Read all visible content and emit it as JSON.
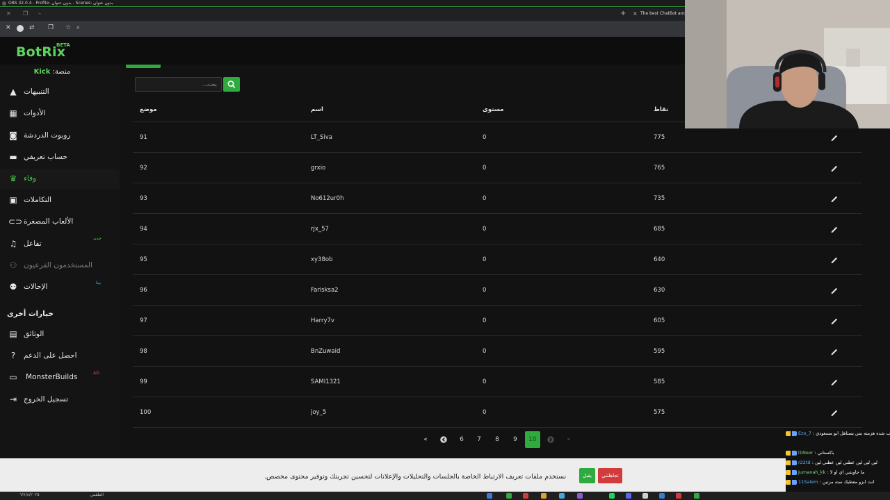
{
  "obs": {
    "title": "OBS 32.0.4 - Profile: بدون عنوان - Scenes: بدون عنوان"
  },
  "browser": {
    "tab_title": "The best ChatBot and W",
    "new_tab_symbol": "+",
    "close_tab_symbol": "×"
  },
  "app": {
    "logo": "BotRix",
    "beta": "BETA",
    "platform_prefix": "منصة:",
    "platform_name": "Kick"
  },
  "sidebar": {
    "items": [
      {
        "label": "التنبيهات",
        "icon": "alert-icon"
      },
      {
        "label": "الأدوات",
        "icon": "grid-icon"
      },
      {
        "label": "روبوت الدردشة",
        "icon": "robot-icon"
      },
      {
        "label": "حساب تعريفي",
        "icon": "id-card-icon"
      },
      {
        "label": "وفاء",
        "icon": "trophy-icon",
        "active": true
      },
      {
        "label": "التكاملات",
        "icon": "plug-icon"
      },
      {
        "label": "الألعاب المصغرة",
        "icon": "gamepad-icon"
      },
      {
        "label": "تفاعل",
        "icon": "music-icon",
        "badge": "جديد"
      },
      {
        "label": "المستخدمون الفرعيون",
        "icon": "users-icon",
        "disabled": true
      },
      {
        "label": "الإحالات",
        "icon": "referrals-icon",
        "badge": "بيتا"
      }
    ],
    "other_title": "خيارات أخرى",
    "other_items": [
      {
        "label": "الوثائق",
        "icon": "book-icon"
      },
      {
        "label": "احصل على الدعم",
        "icon": "help-icon"
      },
      {
        "label": "MonsterBuilds",
        "icon": "laptop-icon",
        "badge": "AD"
      },
      {
        "label": "تسجيل الخروج",
        "icon": "logout-icon"
      }
    ]
  },
  "search": {
    "placeholder": "بحث..."
  },
  "table": {
    "headers": {
      "position": "موضع",
      "name": "اسم",
      "level": "مستوى",
      "points": "نقاط"
    },
    "rows": [
      {
        "position": "91",
        "name": "LT_Siva",
        "level": "0",
        "points": "775"
      },
      {
        "position": "92",
        "name": "grxio",
        "level": "0",
        "points": "765"
      },
      {
        "position": "93",
        "name": "No612ur0h",
        "level": "0",
        "points": "735"
      },
      {
        "position": "94",
        "name": "rjx_57",
        "level": "0",
        "points": "685"
      },
      {
        "position": "95",
        "name": "xy38ob",
        "level": "0",
        "points": "640"
      },
      {
        "position": "96",
        "name": "Farisksa2",
        "level": "0",
        "points": "630"
      },
      {
        "position": "97",
        "name": "Harry7v",
        "level": "0",
        "points": "605"
      },
      {
        "position": "98",
        "name": "BnZuwaid",
        "level": "0",
        "points": "595"
      },
      {
        "position": "99",
        "name": "SAMI1321",
        "level": "0",
        "points": "585"
      },
      {
        "position": "100",
        "name": "joy_5",
        "level": "0",
        "points": "575"
      }
    ]
  },
  "pagination": {
    "first": "«",
    "pages": [
      "6",
      "7",
      "8",
      "9",
      "10"
    ],
    "current": "10",
    "last": "»"
  },
  "cookie": {
    "message": "نستخدم ملفات تعريف الارتباط الخاصة بالجلسات والتحليلات والإعلانات لتحسين تجربتك وتوفير محتوى مخصص.",
    "accept": "يقبل",
    "ignore": "تجاهلتني"
  },
  "chat": [
    {
      "user": "Ezo_7",
      "text": "ابو العب شده هزمته بس يستاهل ابو مسعودي"
    },
    {
      "user": "l1Noor",
      "text": "باكستاني"
    },
    {
      "user": "r22td",
      "text": "لين لين لين عطني لين عطني لين"
    },
    {
      "user": "Jumanah_kk",
      "text": "ما جاوبتني اي او لا"
    },
    {
      "user": "11Salem",
      "text": "انت ابزو معطيك سته مرتين"
    }
  ],
  "taskbar": {
    "clock": "٦/٧/٨/٢٠٢٥",
    "weather": "الطقس"
  },
  "colors": {
    "accent": "#2faa3f",
    "logo": "#5fd35f",
    "danger": "#d23b3b"
  }
}
